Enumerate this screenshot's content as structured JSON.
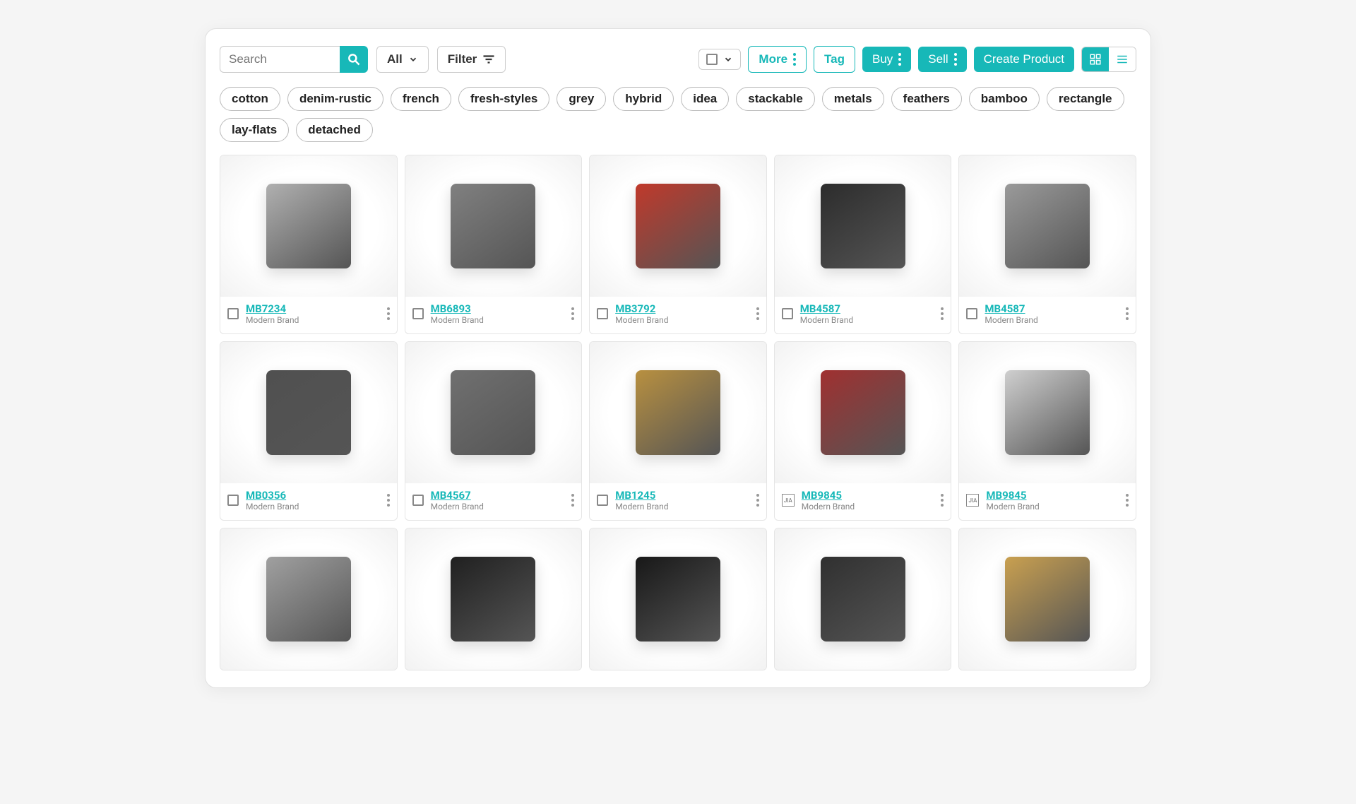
{
  "colors": {
    "accent": "#17b8b8"
  },
  "toolbar": {
    "search_placeholder": "Search",
    "all_label": "All",
    "filter_label": "Filter",
    "more_label": "More",
    "tag_label": "Tag",
    "buy_label": "Buy",
    "sell_label": "Sell",
    "create_label": "Create Product"
  },
  "tags": [
    "cotton",
    "denim-rustic",
    "french",
    "fresh-styles",
    "grey",
    "hybrid",
    "idea",
    "stackable",
    "metals",
    "feathers",
    "bamboo",
    "rectangle",
    "lay-flats",
    "detached"
  ],
  "brand_label": "Modern Brand",
  "products": [
    {
      "sku": "MB7234",
      "brand": "Modern Brand",
      "selector": "checkbox"
    },
    {
      "sku": "MB6893",
      "brand": "Modern Brand",
      "selector": "checkbox"
    },
    {
      "sku": "MB3792",
      "brand": "Modern Brand",
      "selector": "checkbox"
    },
    {
      "sku": "MB4587",
      "brand": "Modern Brand",
      "selector": "checkbox"
    },
    {
      "sku": "MB4587",
      "brand": "Modern Brand",
      "selector": "checkbox"
    },
    {
      "sku": "MB0356",
      "brand": "Modern Brand",
      "selector": "checkbox"
    },
    {
      "sku": "MB4567",
      "brand": "Modern Brand",
      "selector": "checkbox"
    },
    {
      "sku": "MB1245",
      "brand": "Modern Brand",
      "selector": "checkbox"
    },
    {
      "sku": "MB9845",
      "brand": "Modern Brand",
      "selector": "brand-icon"
    },
    {
      "sku": "MB9845",
      "brand": "Modern Brand",
      "selector": "brand-icon"
    },
    {
      "sku": "",
      "brand": "",
      "selector": "none"
    },
    {
      "sku": "",
      "brand": "",
      "selector": "none"
    },
    {
      "sku": "",
      "brand": "",
      "selector": "none"
    },
    {
      "sku": "",
      "brand": "",
      "selector": "none"
    },
    {
      "sku": "",
      "brand": "",
      "selector": "none"
    }
  ]
}
